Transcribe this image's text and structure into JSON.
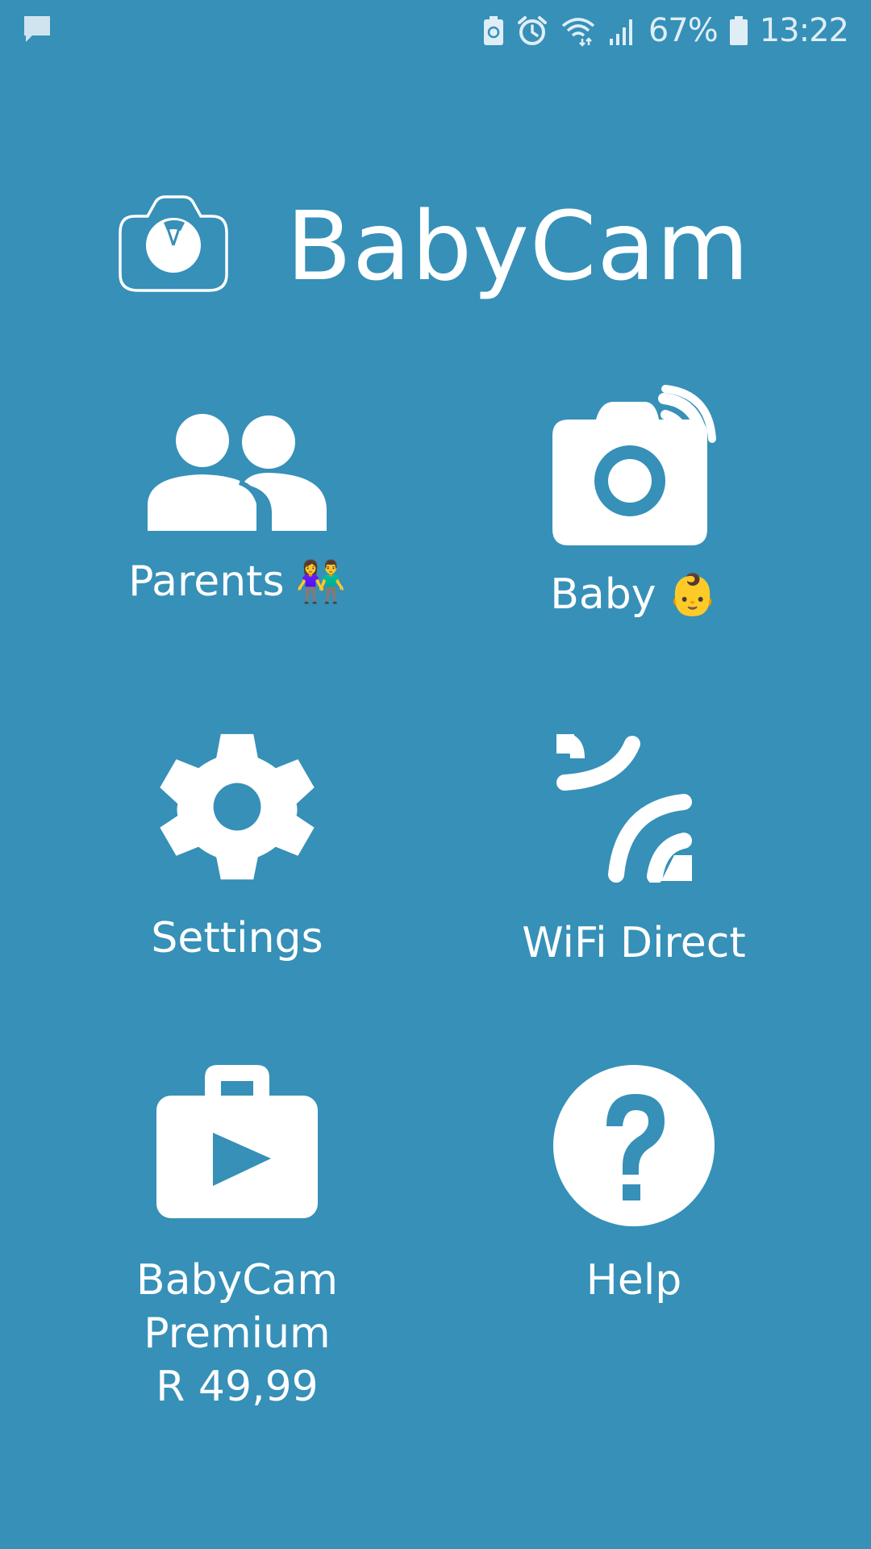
{
  "status_bar": {
    "battery_percent": "67%",
    "time": "13:22",
    "icons": [
      "chat-notification-icon",
      "battery-saver-icon",
      "alarm-icon",
      "wifi-icon",
      "signal-icon",
      "battery-icon"
    ]
  },
  "header": {
    "title": "BabyCam",
    "logo_icon": "camera-logo-icon"
  },
  "menu": {
    "parents": {
      "label": "Parents",
      "emoji": "👫",
      "icon": "people-icon"
    },
    "baby": {
      "label": "Baby",
      "emoji": "👶",
      "icon": "camera-broadcast-icon"
    },
    "settings": {
      "label": "Settings",
      "icon": "gear-icon"
    },
    "wifi_direct": {
      "label": "WiFi Direct",
      "icon": "wifi-direct-icon"
    },
    "premium": {
      "line1": "BabyCam",
      "line2": "Premium",
      "price": "R 49,99",
      "icon": "store-play-icon"
    },
    "help": {
      "label": "Help",
      "icon": "help-icon"
    }
  },
  "colors": {
    "background": "#3690B8",
    "foreground": "#FFFFFF"
  }
}
